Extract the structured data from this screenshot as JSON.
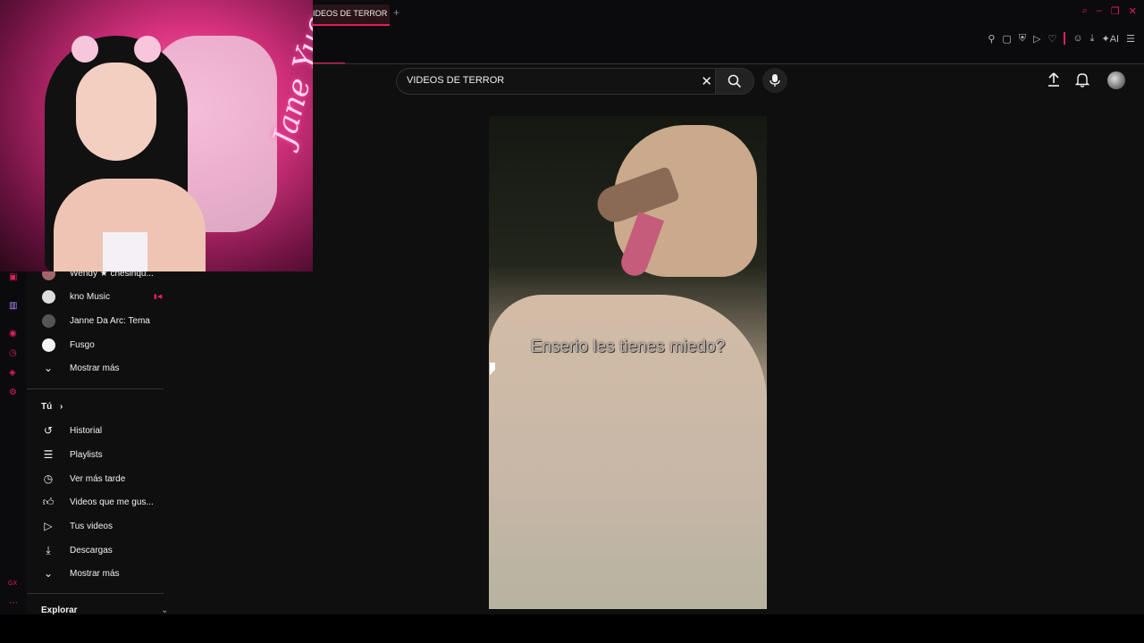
{
  "browser": {
    "tab_title": "IDEOS DE TERROR -",
    "tab_add": "+",
    "ai_label": "AI"
  },
  "webcam": {
    "neon_text": "Jane Yue"
  },
  "search": {
    "query": "VIDEOS DE TERROR"
  },
  "sidebar": {
    "subscriptions": [
      {
        "label": "Wendy ★ chesinqu...",
        "live": true
      },
      {
        "label": "kno Music",
        "live": true
      },
      {
        "label": "Janne Da Arc: Tema",
        "live": false
      },
      {
        "label": "Fusgo",
        "live": false
      }
    ],
    "show_more_1": "Mostrar más",
    "you_section": "Tú",
    "you_items": [
      {
        "label": "Historial",
        "icon": "history-icon"
      },
      {
        "label": "Playlists",
        "icon": "playlists-icon"
      },
      {
        "label": "Ver más tarde",
        "icon": "watch-later-icon"
      },
      {
        "label": "Videos que me gus...",
        "icon": "liked-videos-icon"
      },
      {
        "label": "Tus videos",
        "icon": "your-videos-icon"
      },
      {
        "label": "Descargas",
        "icon": "downloads-icon"
      }
    ],
    "show_more_2": "Mostrar más",
    "explore_section": "Explorar"
  },
  "video": {
    "caption": "Enserio les tienes miedo?"
  },
  "colors": {
    "accent": "#e0205a",
    "background": "#0f0f0f"
  }
}
